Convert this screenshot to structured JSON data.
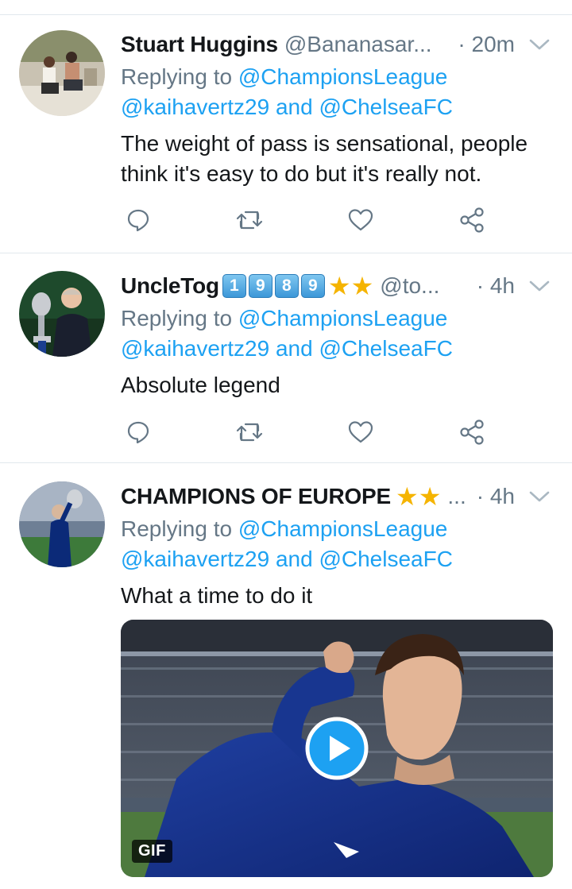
{
  "tweets": [
    {
      "name": "Stuart Huggins",
      "handle": "@Bananasar...",
      "time": "· 20m",
      "replying_prefix": "Replying to",
      "replying_to": "@ChampionsLeague",
      "mention_1": "@kaihavertz29",
      "mention_joiner": "and",
      "mention_2": "@ChelseaFC",
      "text_line_1": "The weight of pass is sensational, people",
      "text_line_2": "think it's easy to do but it's really not."
    },
    {
      "name": "UncleTog",
      "name_badges": [
        "1",
        "9",
        "8",
        "9"
      ],
      "name_stars": "★★",
      "handle": "@to...",
      "time": "· 4h",
      "replying_prefix": "Replying to",
      "replying_to": "@ChampionsLeague",
      "mention_1": "@kaihavertz29",
      "mention_joiner": "and",
      "mention_2": "@ChelseaFC",
      "text_line_1": "Absolute legend"
    },
    {
      "name": "CHAMPIONS OF EUROPE",
      "name_stars": "★★",
      "handle": "...",
      "time": "· 4h",
      "replying_prefix": "Replying to",
      "replying_to": "@ChampionsLeague",
      "mention_1": "@kaihavertz29",
      "mention_joiner": "and",
      "mention_2": "@ChelseaFC",
      "text_line_1": "What a time to do it",
      "media_badge": "GIF"
    }
  ],
  "actions": [
    "reply-icon",
    "retweet-icon",
    "like-icon",
    "share-icon"
  ],
  "colors": {
    "link": "#1da1f2",
    "muted": "#657786",
    "icon": "#657786",
    "divider": "#e1e8ed"
  }
}
